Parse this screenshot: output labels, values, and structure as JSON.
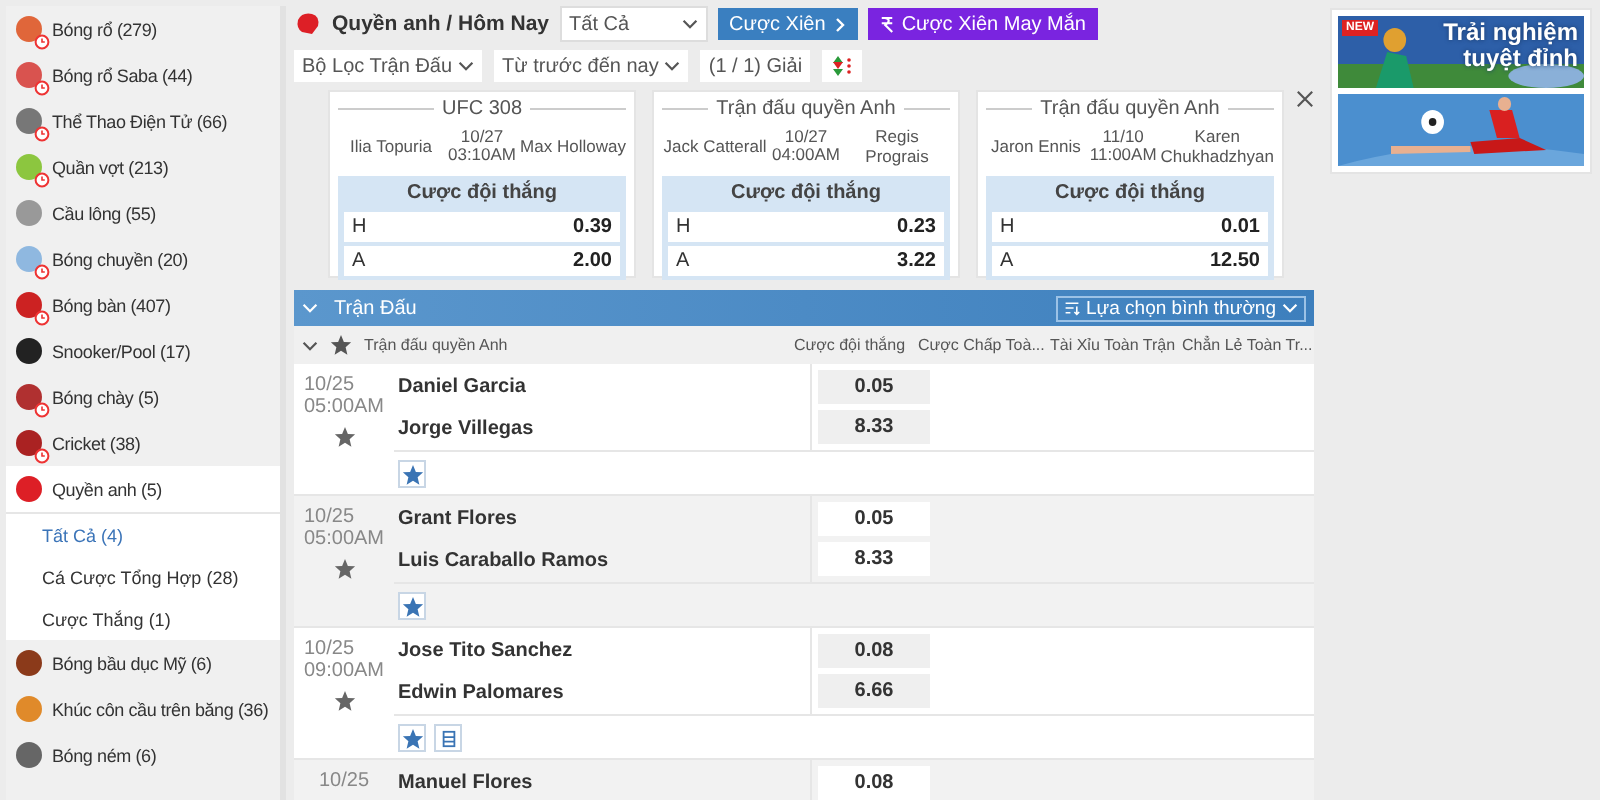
{
  "sidebar": {
    "items": [
      {
        "label": "Bóng rổ",
        "count": "(279)",
        "color": "#e0663a",
        "live": true,
        "expanded": false
      },
      {
        "label": "Bóng rổ Saba",
        "count": "(44)",
        "color": "#d9534f",
        "live": true,
        "expanded": false
      },
      {
        "label": "Thể Thao Điện Tử",
        "count": "(66)",
        "color": "#777777",
        "live": true,
        "expanded": false
      },
      {
        "label": "Quần vợt",
        "count": "(213)",
        "color": "#8cc63f",
        "live": true,
        "expanded": false
      },
      {
        "label": "Cầu lông",
        "count": "(55)",
        "color": "#999999",
        "live": false,
        "expanded": false
      },
      {
        "label": "Bóng chuyền",
        "count": "(20)",
        "color": "#8fb8e0",
        "live": true,
        "expanded": false
      },
      {
        "label": "Bóng bàn",
        "count": "(407)",
        "color": "#cc2222",
        "live": true,
        "expanded": false
      },
      {
        "label": "Snooker/Pool",
        "count": "(17)",
        "color": "#222222",
        "live": false,
        "expanded": false
      },
      {
        "label": "Bóng chày",
        "count": "(5)",
        "color": "#b03030",
        "live": true,
        "expanded": false
      },
      {
        "label": "Cricket",
        "count": "(38)",
        "color": "#aa2222",
        "live": true,
        "expanded": false
      },
      {
        "label": "Quyền anh",
        "count": "(5)",
        "color": "#dd1f26",
        "live": false,
        "expanded": true,
        "children": [
          {
            "label": "Tất Cả",
            "count": "(4)",
            "selected": true
          },
          {
            "label": "Cá Cược Tổng Hợp",
            "count": "(28)",
            "selected": false
          },
          {
            "label": "Cược Thắng",
            "count": "(1)",
            "selected": false
          }
        ]
      },
      {
        "label": "Bóng bầu dục Mỹ",
        "count": "(6)",
        "color": "#8b3a1a",
        "live": false,
        "expanded": false
      },
      {
        "label": "Khúc côn cầu trên băng",
        "count": "(36)",
        "color": "#e08a2a",
        "live": false,
        "expanded": false
      },
      {
        "label": "Bóng ném",
        "count": "(6)",
        "color": "#666666",
        "live": false,
        "expanded": false
      }
    ]
  },
  "header": {
    "breadcrumb": "Quyền anh / Hôm Nay",
    "select": "Tất Cả",
    "buttons": [
      {
        "label": "Cược Xiên",
        "kind": "parlay"
      },
      {
        "label": "Cược Xiên May Mắn",
        "kind": "lucky"
      }
    ]
  },
  "filters": {
    "match_filter": "Bộ Lọc Trận Đấu",
    "period": "Từ trước đến nay",
    "league_count": "(1 / 1) Giải"
  },
  "featured": [
    {
      "title": "UFC 308",
      "home": "Ilia Topuria",
      "date": "10/27",
      "time": "03:10AM",
      "away": "Max Holloway",
      "market": "Cược đội thắng",
      "lines": [
        {
          "label": "H",
          "odds": "0.39"
        },
        {
          "label": "A",
          "odds": "2.00"
        }
      ]
    },
    {
      "title": "Trận đấu quyền Anh",
      "home": "Jack Catterall",
      "date": "10/27",
      "time": "04:00AM",
      "away": "Regis Prograis",
      "market": "Cược đội thắng",
      "lines": [
        {
          "label": "H",
          "odds": "0.23"
        },
        {
          "label": "A",
          "odds": "3.22"
        }
      ]
    },
    {
      "title": "Trận đấu quyền Anh",
      "home": "Jaron Ennis",
      "date": "11/10",
      "time": "11:00AM",
      "away": "Karen Chukhadzhyan",
      "market": "Cược đội thắng",
      "lines": [
        {
          "label": "H",
          "odds": "0.01"
        },
        {
          "label": "A",
          "odds": "12.50"
        }
      ]
    }
  ],
  "section": {
    "title": "Trận Đấu",
    "expanded": true,
    "sort": "Lựa chọn bình thường"
  },
  "league": {
    "name": "Trận đấu quyền Anh",
    "expanded": true,
    "columns": [
      "Cược đội thắng",
      "Cược Chấp Toà...",
      "Tài Xỉu Toàn Trận",
      "Chẳn Lẻ Toàn Tr..."
    ]
  },
  "matches": [
    {
      "date": "10/25",
      "time": "05:00AM",
      "participants": [
        {
          "name": "Daniel Garcia",
          "odds": "0.05"
        },
        {
          "name": "Jorge Villegas",
          "odds": "8.33"
        }
      ],
      "favorite_button": true,
      "stats_button": false
    },
    {
      "date": "10/25",
      "time": "05:00AM",
      "participants": [
        {
          "name": "Grant Flores",
          "odds": "0.05"
        },
        {
          "name": "Luis Caraballo Ramos",
          "odds": "8.33"
        }
      ],
      "favorite_button": true,
      "stats_button": false
    },
    {
      "date": "10/25",
      "time": "09:00AM",
      "participants": [
        {
          "name": "Jose Tito Sanchez",
          "odds": "0.08"
        },
        {
          "name": "Edwin Palomares",
          "odds": "6.66"
        }
      ],
      "favorite_button": true,
      "stats_button": true
    },
    {
      "date": "10/25",
      "participants": [
        {
          "name": "Manuel Flores",
          "odds": "0.08"
        }
      ]
    }
  ],
  "banners": [
    {
      "kind": "picture",
      "badge": "NEW",
      "headline": "Trải nghiệm tuyệt đỉnh"
    },
    {
      "kind": "picture"
    }
  ]
}
